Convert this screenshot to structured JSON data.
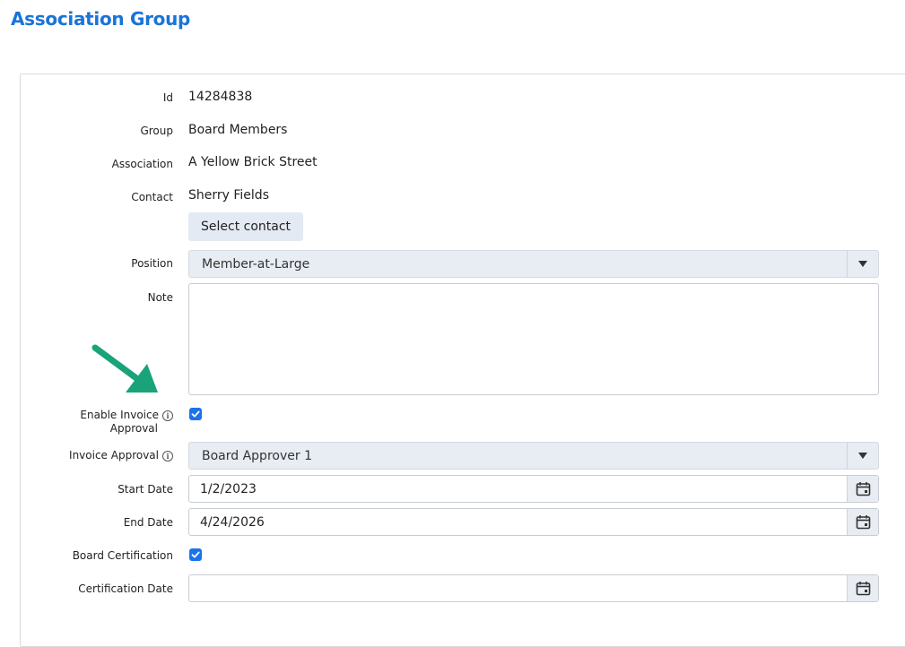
{
  "page": {
    "title": "Association Group"
  },
  "form": {
    "id": {
      "label": "Id",
      "value": "14284838"
    },
    "group": {
      "label": "Group",
      "value": "Board Members"
    },
    "association": {
      "label": "Association",
      "value": "A Yellow Brick Street"
    },
    "contact": {
      "label": "Contact",
      "value": "Sherry Fields",
      "button_label": "Select contact"
    },
    "position": {
      "label": "Position",
      "value": "Member-at-Large"
    },
    "note": {
      "label": "Note",
      "value": ""
    },
    "enable_invoice_approval": {
      "label_line1": "Enable Invoice",
      "label_line2": "Approval",
      "checked": true
    },
    "invoice_approval": {
      "label": "Invoice Approval",
      "value": "Board Approver 1"
    },
    "start_date": {
      "label": "Start Date",
      "value": "1/2/2023"
    },
    "end_date": {
      "label": "End Date",
      "value": "4/24/2026"
    },
    "board_certification": {
      "label": "Board Certification",
      "checked": true
    },
    "certification_date": {
      "label": "Certification Date",
      "value": ""
    }
  },
  "colors": {
    "accent": "#1a73d9",
    "checkbox": "#1a73e8",
    "annotation_arrow": "#1aa37a"
  },
  "icons": {
    "dropdown": "chevron-down-icon",
    "calendar": "calendar-icon",
    "info": "info-icon"
  }
}
